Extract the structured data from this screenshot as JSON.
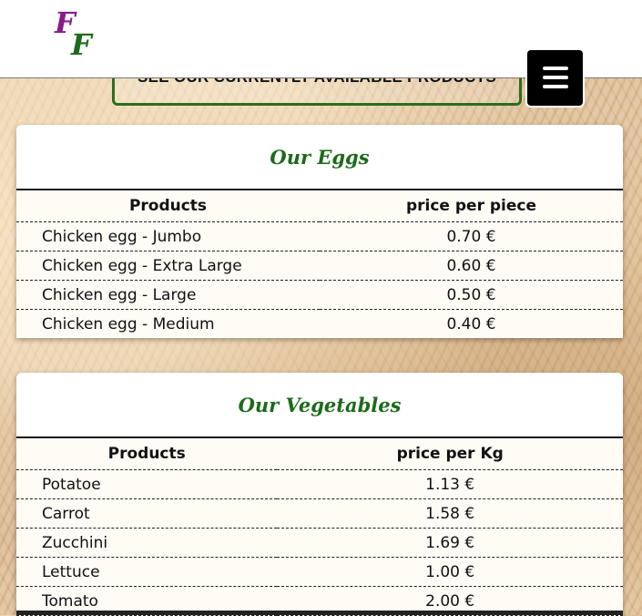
{
  "header": {
    "logo_text": "FF",
    "menu_icon": "hamburger-icon"
  },
  "products_link": {
    "label": "SEE OUR CURRENTLY AVAILABLE PRODUCTS"
  },
  "eggs": {
    "title": "Our Eggs",
    "columns": [
      "Products",
      "price per piece"
    ],
    "rows": [
      {
        "name": "Chicken egg - Jumbo",
        "price": "0.70 €"
      },
      {
        "name": "Chicken egg - Extra Large",
        "price": "0.60 €"
      },
      {
        "name": "Chicken egg - Large",
        "price": "0.50 €"
      },
      {
        "name": "Chicken egg - Medium",
        "price": "0.40 €"
      }
    ]
  },
  "vegetables": {
    "title": "Our Vegetables",
    "columns": [
      "Products",
      "price per Kg"
    ],
    "rows": [
      {
        "name": "Potatoe",
        "price": "1.13 €"
      },
      {
        "name": "Carrot",
        "price": "1.58 €"
      },
      {
        "name": "Zucchini",
        "price": "1.69 €"
      },
      {
        "name": "Lettuce",
        "price": "1.00 €"
      },
      {
        "name": "Tomato",
        "price": "2.00 €"
      }
    ]
  },
  "colors": {
    "brand_green": "#1d6a1a",
    "logo_purple": "#8a1a8a",
    "menu_bg": "#000000"
  }
}
